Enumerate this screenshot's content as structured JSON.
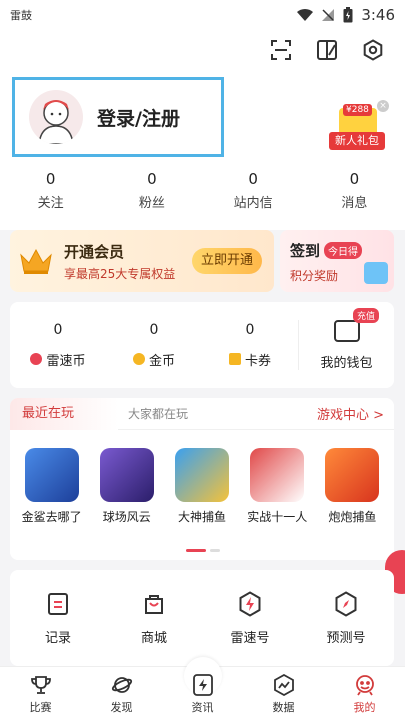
{
  "status_bar": {
    "carrier": "雷鼓",
    "time": "3:46"
  },
  "header": {
    "icons": [
      "scan-icon",
      "split-view-icon",
      "settings-icon"
    ]
  },
  "profile": {
    "login_label": "登录/注册"
  },
  "gift": {
    "amount": "¥288",
    "label": "新人礼包",
    "close": "×"
  },
  "stats": [
    {
      "value": "0",
      "label": "关注"
    },
    {
      "value": "0",
      "label": "粉丝"
    },
    {
      "value": "0",
      "label": "站内信"
    },
    {
      "value": "0",
      "label": "消息"
    }
  ],
  "vip": {
    "title": "开通会员",
    "subtitle": "享最高25大专属权益",
    "button": "立即开通"
  },
  "sign_in": {
    "title": "签到",
    "badge": "今日得",
    "subtitle": "积分奖励"
  },
  "wallet": {
    "items": [
      {
        "value": "0",
        "label": "雷速币",
        "color": "#e84353"
      },
      {
        "value": "0",
        "label": "金币",
        "color": "#f5b623"
      },
      {
        "value": "0",
        "label": "卡券",
        "color": "#f5b623"
      }
    ],
    "my_wallet": {
      "label": "我的钱包",
      "tag": "充值"
    }
  },
  "games": {
    "tab_active": "最近在玩",
    "tab_inactive": "大家都在玩",
    "center_link": "游戏中心 >",
    "items": [
      {
        "name": "金鲨去哪了",
        "color": "#2f6fd1"
      },
      {
        "name": "球场风云",
        "color": "#5a3aa8"
      },
      {
        "name": "大神捕鱼",
        "color": "#1d7fd8"
      },
      {
        "name": "实战十一人",
        "color": "#c93030"
      },
      {
        "name": "炮炮捕鱼",
        "color": "#e86a2a"
      }
    ]
  },
  "tools": [
    {
      "label": "记录",
      "icon": "record-icon"
    },
    {
      "label": "商城",
      "icon": "shopping-bag-icon"
    },
    {
      "label": "雷速号",
      "icon": "lightning-shield-icon"
    },
    {
      "label": "预测号",
      "icon": "compass-icon"
    }
  ],
  "bottom_nav": [
    {
      "label": "比赛",
      "icon": "trophy-icon"
    },
    {
      "label": "发现",
      "icon": "planet-icon"
    },
    {
      "label": "资讯",
      "icon": "news-lightning-icon"
    },
    {
      "label": "数据",
      "icon": "data-chart-icon"
    },
    {
      "label": "我的",
      "icon": "profile-icon",
      "active": true
    }
  ],
  "colors": {
    "accent": "#d23b3b",
    "highlight_border": "#4fb3e6"
  }
}
